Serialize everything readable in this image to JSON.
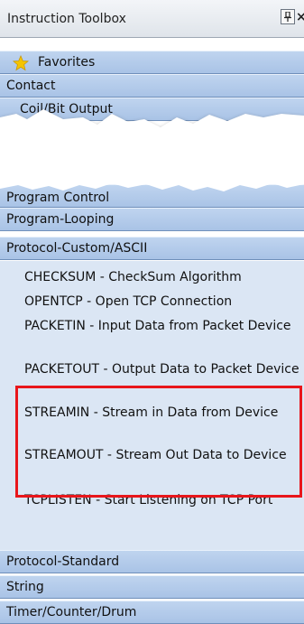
{
  "window": {
    "title": "Instruction Toolbox",
    "close_glyph": "×",
    "pin_icon": "pin-icon"
  },
  "categories": {
    "favorites": "Favorites",
    "contact": "Contact",
    "coil_bit_output": "Coil/Bit Output",
    "program_control": "Program Control",
    "program_looping": "Program-Looping",
    "protocol_custom": "Protocol-Custom/ASCII",
    "protocol_standard": "Protocol-Standard",
    "string": "String",
    "timer_counter_drum": "Timer/Counter/Drum"
  },
  "instructions": [
    {
      "label": "CHECKSUM - CheckSum Algorithm"
    },
    {
      "label": "OPENTCP - Open TCP Connection"
    },
    {
      "label": "PACKETIN - Input Data from Packet Device"
    },
    {
      "label": "PACKETOUT - Output Data to Packet Device"
    },
    {
      "label": "STREAMIN - Stream in Data from Device"
    },
    {
      "label": "STREAMOUT - Stream Out Data to Device"
    },
    {
      "label": "TCPLISTEN - Start Listening on TCP Port"
    }
  ],
  "colors": {
    "header": "#b3cbea",
    "list_bg": "#dbe6f4",
    "highlight": "#e8161b",
    "star": "#f5c400"
  }
}
